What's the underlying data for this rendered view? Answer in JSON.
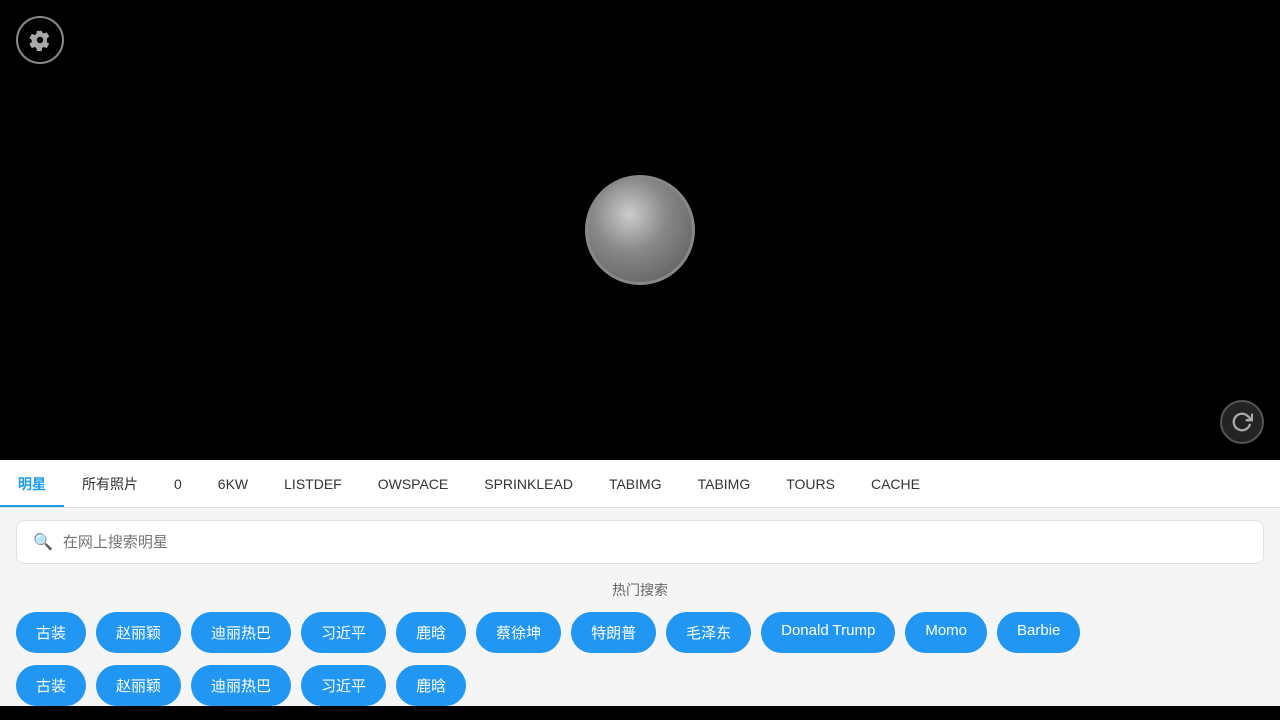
{
  "app": {
    "background": "#000000"
  },
  "top_area": {
    "settings_label": "settings"
  },
  "tabs": {
    "items": [
      {
        "label": "明星",
        "active": true
      },
      {
        "label": "所有照片",
        "active": false
      },
      {
        "label": "0",
        "active": false
      },
      {
        "label": "6KW",
        "active": false
      },
      {
        "label": "LISTDEF",
        "active": false
      },
      {
        "label": "OWSPACE",
        "active": false
      },
      {
        "label": "SPRINKLEAD",
        "active": false
      },
      {
        "label": "TABIMG",
        "active": false
      },
      {
        "label": "TABIMG",
        "active": false
      },
      {
        "label": "TOURS",
        "active": false
      },
      {
        "label": "CACHE",
        "active": false
      }
    ]
  },
  "search": {
    "placeholder": "在网上搜索明星"
  },
  "hot_search": {
    "title": "热门搜索",
    "tags": [
      {
        "label": "古装"
      },
      {
        "label": "赵丽颖"
      },
      {
        "label": "迪丽热巴"
      },
      {
        "label": "习近平"
      },
      {
        "label": "鹿晗"
      },
      {
        "label": "蔡徐坤"
      },
      {
        "label": "特朗普"
      },
      {
        "label": "毛泽东"
      },
      {
        "label": "Donald Trump"
      },
      {
        "label": "Momo"
      },
      {
        "label": "Barbie"
      }
    ]
  },
  "bottom_tags": [
    {
      "label": "古装"
    },
    {
      "label": "赵丽颖"
    },
    {
      "label": "迪丽热巴"
    },
    {
      "label": "习近平"
    },
    {
      "label": "鹿晗"
    }
  ]
}
